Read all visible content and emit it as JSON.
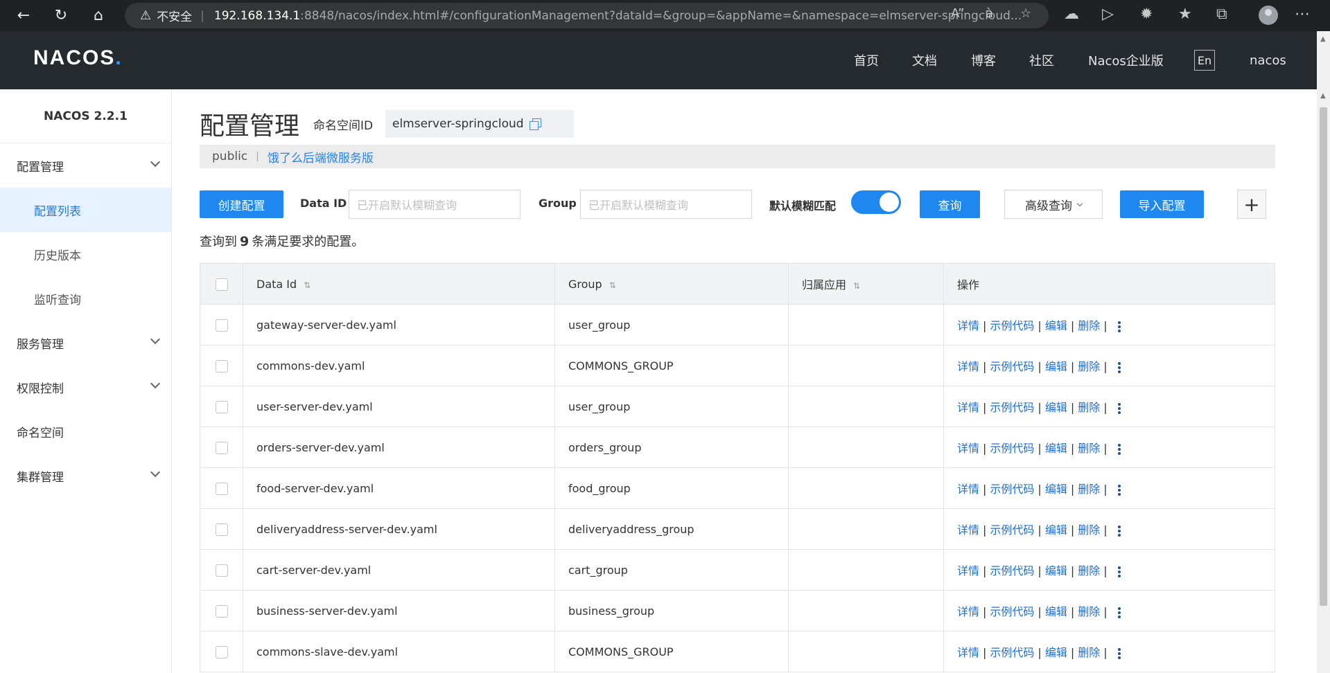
{
  "browser": {
    "security_label": "不安全",
    "url_host": "192.168.134.1",
    "url_path": ":8848/nacos/index.html#/configurationManagement?dataId=&group=&appName=&namespace=elmserver-springcloud..."
  },
  "header": {
    "logo": "NACOS",
    "logo_dot": ".",
    "nav": [
      "首页",
      "文档",
      "博客",
      "社区",
      "Nacos企业版"
    ],
    "lang": "En",
    "user": "nacos"
  },
  "sidebar": {
    "version": "NACOS 2.2.1",
    "config_group": "配置管理",
    "config_items": [
      "配置列表",
      "历史版本",
      "监听查询"
    ],
    "service_group": "服务管理",
    "auth_group": "权限控制",
    "namespace": "命名空间",
    "cluster_group": "集群管理"
  },
  "main": {
    "title": "配置管理",
    "ns_label": "命名空间ID",
    "ns_value": "elmserver-springcloud",
    "ns_tabs": [
      "public",
      "饿了么后端微服务版"
    ]
  },
  "toolbar": {
    "create_label": "创建配置",
    "dataid_label": "Data ID",
    "dataid_placeholder": "已开启默认模糊查询",
    "group_label": "Group",
    "group_placeholder": "已开启默认模糊查询",
    "fuzzy_label": "默认模糊匹配",
    "fuzzy_on": true,
    "query_label": "查询",
    "advanced_label": "高级查询",
    "import_label": "导入配置"
  },
  "result": {
    "prefix": "查询到",
    "count": "9",
    "suffix": "条满足要求的配置。"
  },
  "table": {
    "headers": [
      "Data Id",
      "Group",
      "归属应用",
      "操作"
    ],
    "ops": [
      "详情",
      "示例代码",
      "编辑",
      "删除"
    ],
    "rows": [
      {
        "dataId": "gateway-server-dev.yaml",
        "group": "user_group",
        "app": ""
      },
      {
        "dataId": "commons-dev.yaml",
        "group": "COMMONS_GROUP",
        "app": ""
      },
      {
        "dataId": "user-server-dev.yaml",
        "group": "user_group",
        "app": ""
      },
      {
        "dataId": "orders-server-dev.yaml",
        "group": "orders_group",
        "app": ""
      },
      {
        "dataId": "food-server-dev.yaml",
        "group": "food_group",
        "app": ""
      },
      {
        "dataId": "deliveryaddress-server-dev.yaml",
        "group": "deliveryaddress_group",
        "app": ""
      },
      {
        "dataId": "cart-server-dev.yaml",
        "group": "cart_group",
        "app": ""
      },
      {
        "dataId": "business-server-dev.yaml",
        "group": "business_group",
        "app": ""
      },
      {
        "dataId": "commons-slave-dev.yaml",
        "group": "COMMONS_GROUP",
        "app": ""
      }
    ]
  },
  "colors": {
    "primary": "#1e88f0",
    "header_bg": "#252a2f",
    "link": "#1e6fd0"
  }
}
